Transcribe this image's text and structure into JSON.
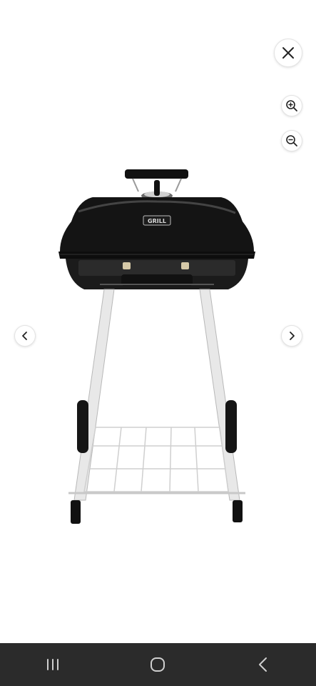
{
  "viewer": {
    "buttons": {
      "close": "close-icon",
      "zoom_in": "zoom-in-icon",
      "zoom_out": "zoom-out-icon",
      "previous": "chevron-left-icon",
      "next": "chevron-right-icon"
    },
    "product_image": {
      "lid_badge_text": "GRILL"
    }
  },
  "nav_bar": {
    "recents": "recents-icon",
    "home": "home-icon",
    "back": "back-icon"
  }
}
